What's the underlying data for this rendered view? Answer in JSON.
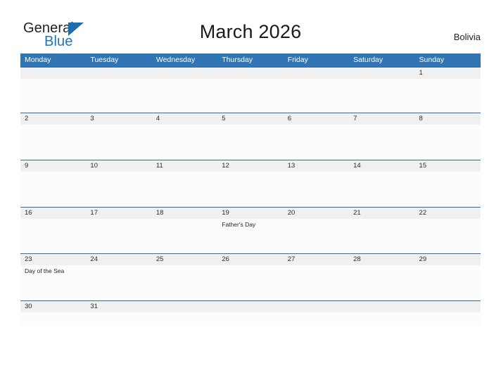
{
  "brand": {
    "name_part1": "General",
    "name_part2": "Blue",
    "triangle_color": "#1b6cb0",
    "blue_color": "#1b75bb"
  },
  "header": {
    "title": "March 2026",
    "region": "Bolivia"
  },
  "colors": {
    "header_blue": "#3174b4",
    "row_divider_blue": "#2e6da8",
    "date_band_gray": "#f0f0f0",
    "cell_background": "#fcfcfc",
    "page_background": "#ffffff"
  },
  "calendar": {
    "month": "March",
    "year": "2026",
    "weekday_headers": [
      "Monday",
      "Tuesday",
      "Wednesday",
      "Thursday",
      "Friday",
      "Saturday",
      "Sunday"
    ],
    "weeks": [
      {
        "days": [
          {
            "number": "",
            "event": ""
          },
          {
            "number": "",
            "event": ""
          },
          {
            "number": "",
            "event": ""
          },
          {
            "number": "",
            "event": ""
          },
          {
            "number": "",
            "event": ""
          },
          {
            "number": "",
            "event": ""
          },
          {
            "number": "1",
            "event": ""
          }
        ]
      },
      {
        "days": [
          {
            "number": "2",
            "event": ""
          },
          {
            "number": "3",
            "event": ""
          },
          {
            "number": "4",
            "event": ""
          },
          {
            "number": "5",
            "event": ""
          },
          {
            "number": "6",
            "event": ""
          },
          {
            "number": "7",
            "event": ""
          },
          {
            "number": "8",
            "event": ""
          }
        ]
      },
      {
        "days": [
          {
            "number": "9",
            "event": ""
          },
          {
            "number": "10",
            "event": ""
          },
          {
            "number": "11",
            "event": ""
          },
          {
            "number": "12",
            "event": ""
          },
          {
            "number": "13",
            "event": ""
          },
          {
            "number": "14",
            "event": ""
          },
          {
            "number": "15",
            "event": ""
          }
        ]
      },
      {
        "days": [
          {
            "number": "16",
            "event": ""
          },
          {
            "number": "17",
            "event": ""
          },
          {
            "number": "18",
            "event": ""
          },
          {
            "number": "19",
            "event": "Father's Day"
          },
          {
            "number": "20",
            "event": ""
          },
          {
            "number": "21",
            "event": ""
          },
          {
            "number": "22",
            "event": ""
          }
        ]
      },
      {
        "days": [
          {
            "number": "23",
            "event": "Day of the Sea"
          },
          {
            "number": "24",
            "event": ""
          },
          {
            "number": "25",
            "event": ""
          },
          {
            "number": "26",
            "event": ""
          },
          {
            "number": "27",
            "event": ""
          },
          {
            "number": "28",
            "event": ""
          },
          {
            "number": "29",
            "event": ""
          }
        ]
      },
      {
        "days": [
          {
            "number": "30",
            "event": ""
          },
          {
            "number": "31",
            "event": ""
          },
          {
            "number": "",
            "event": ""
          },
          {
            "number": "",
            "event": ""
          },
          {
            "number": "",
            "event": ""
          },
          {
            "number": "",
            "event": ""
          },
          {
            "number": "",
            "event": ""
          }
        ]
      }
    ]
  }
}
